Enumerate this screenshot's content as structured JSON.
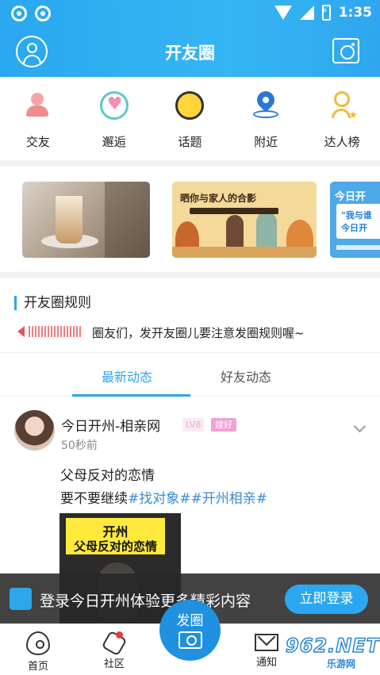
{
  "status_bar": {
    "time": "1:35"
  },
  "header": {
    "title": "开友圈"
  },
  "quick_menu": [
    {
      "label": "交友",
      "icon": "friends-icon"
    },
    {
      "label": "邂逅",
      "icon": "encounter-icon"
    },
    {
      "label": "话题",
      "icon": "topic-icon"
    },
    {
      "label": "附近",
      "icon": "location-pin-icon"
    },
    {
      "label": "达人榜",
      "icon": "ranking-icon"
    }
  ],
  "banners": [
    {
      "text": ""
    },
    {
      "title": "晒你与家人的合影"
    },
    {
      "title": "今日开",
      "line1": "\"我与谁",
      "line2": "今日开"
    }
  ],
  "rules": {
    "title": "开友圈规则",
    "text": "圈友们，发开友圈儿要注意发圈规则喔~"
  },
  "tabs": [
    {
      "label": "最新动态",
      "active": true
    },
    {
      "label": "好友动态",
      "active": false
    }
  ],
  "post": {
    "author": "今日开州-相亲网",
    "level": "LV8",
    "tag": "嫂好",
    "time": "50秒前",
    "line1": "父母反对的恋情",
    "line2_prefix": "要不要继续",
    "hashtags": "#找对象##开州相亲#",
    "image_title1": "开州",
    "image_title2": "父母反对的恋情"
  },
  "login_bar": {
    "logo": "今日开州",
    "text": "登录今日开州体验更多精彩内容",
    "button": "立即登录"
  },
  "bottom_nav": {
    "home": "首页",
    "community": "社区",
    "post": "发圈",
    "notify": "通知"
  },
  "watermark": {
    "main": "962.NET",
    "sub": "乐游网"
  },
  "colors": {
    "accent": "#2aa7f0",
    "hashtag": "#3a8bd6",
    "alert": "#e53c3c"
  }
}
